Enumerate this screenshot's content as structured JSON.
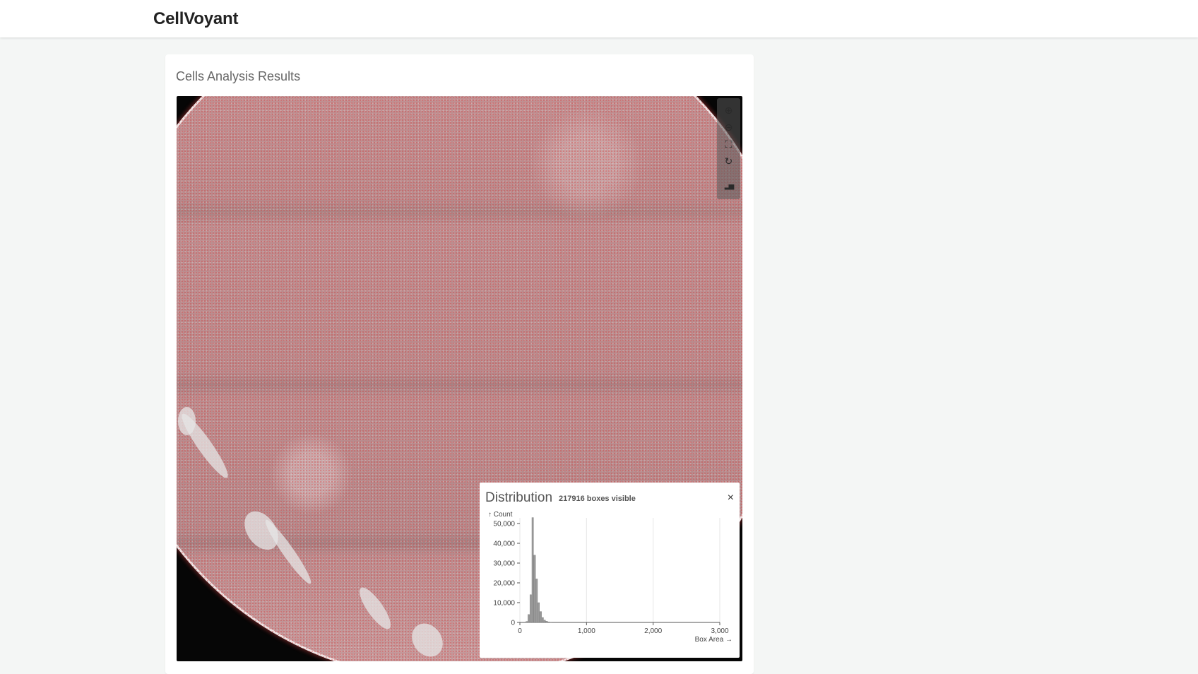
{
  "app": {
    "title": "CellVoyant"
  },
  "card": {
    "title": "Cells Analysis Results"
  },
  "toolbar": {
    "items": [
      {
        "icon": "zoom-in-icon",
        "glyph": "⊕"
      },
      {
        "icon": "zoom-out-icon",
        "glyph": "⊖"
      },
      {
        "icon": "fit-screen-icon",
        "glyph": "⛶"
      },
      {
        "icon": "reset-rotate-icon",
        "glyph": "↻"
      },
      {
        "icon": "histogram-icon",
        "glyph": "▂▅"
      }
    ]
  },
  "distribution": {
    "title": "Distribution",
    "subtitle": "217916 boxes visible",
    "close": "×"
  },
  "chart_data": {
    "type": "bar",
    "ylabel": "↑ Count",
    "xlabel": "Box Area →",
    "xlim": [
      0,
      3000
    ],
    "ylim": [
      0,
      50000
    ],
    "xticks": [
      "0",
      "1,000",
      "2,000",
      "3,000"
    ],
    "yticks": [
      "0",
      "10,000",
      "20,000",
      "30,000",
      "40,000",
      "50,000"
    ],
    "grid": true,
    "bin_width": 30,
    "bins": [
      {
        "x": 90,
        "y": 500
      },
      {
        "x": 120,
        "y": 4000
      },
      {
        "x": 150,
        "y": 14000
      },
      {
        "x": 180,
        "y": 53000
      },
      {
        "x": 210,
        "y": 34000
      },
      {
        "x": 240,
        "y": 22000
      },
      {
        "x": 270,
        "y": 10000
      },
      {
        "x": 300,
        "y": 5500
      },
      {
        "x": 330,
        "y": 2500
      },
      {
        "x": 360,
        "y": 1200
      },
      {
        "x": 390,
        "y": 600
      },
      {
        "x": 420,
        "y": 300
      },
      {
        "x": 450,
        "y": 150
      }
    ]
  }
}
